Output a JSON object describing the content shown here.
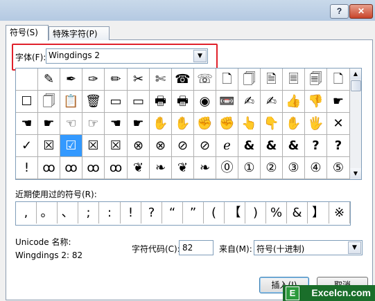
{
  "titlebar": {
    "help": "?",
    "close": "✕"
  },
  "tabs": [
    {
      "label": "符号(S)"
    },
    {
      "label": "特殊字符(P)"
    }
  ],
  "font": {
    "label": "字体(F):",
    "value": "Wingdings 2"
  },
  "grid": {
    "rows": [
      [
        "",
        "✎",
        "✒",
        "✑",
        "✏",
        "✂",
        "✄",
        "☎",
        "☏",
        "🗋",
        "🗍",
        "🗎",
        "🗏",
        "🗐",
        "🗋"
      ],
      [
        "☐",
        "🗍",
        "📋",
        "🗑",
        "▭",
        "▭",
        "🖶",
        "🖶",
        "◉",
        "📼",
        "✍",
        "✍",
        "👍",
        "👎",
        "☛"
      ],
      [
        "☚",
        "☛",
        "☜",
        "☞",
        "☚",
        "☛",
        "✋",
        "✋",
        "✊",
        "✊",
        "👆",
        "👇",
        "✋",
        "🖐",
        "✕"
      ],
      [
        "✓",
        "☒",
        "☑",
        "☒",
        "☒",
        "⊗",
        "⊗",
        "⊘",
        "⊘",
        "ℯ",
        "&",
        "&",
        "&",
        "?",
        "?"
      ],
      [
        "!",
        "ꝏ",
        "ꝏ",
        "ꝏ",
        "ꝏ",
        "❦",
        "❧",
        "❦",
        "❧",
        "⓪",
        "①",
        "②",
        "③",
        "④",
        "⑤"
      ]
    ],
    "last_col": [
      "🗋",
      "☛",
      "✕",
      "?",
      "⑥"
    ],
    "selected": {
      "row": 3,
      "col": 2
    }
  },
  "recent": {
    "label": "近期使用过的符号(R):",
    "items": [
      ",",
      "。",
      "、",
      ";",
      ":",
      "!",
      "?",
      "“",
      "”",
      "(",
      "【",
      ")",
      "%",
      "&",
      "】",
      "※"
    ]
  },
  "unicode": {
    "label": "Unicode 名称:",
    "name": "Wingdings 2: 82"
  },
  "code": {
    "label": "字符代码(C):",
    "value": "82"
  },
  "from": {
    "label": "来自(M):",
    "value": "符号(十进制)"
  },
  "buttons": {
    "insert": "插入(I)",
    "cancel": "取消"
  },
  "watermark": {
    "text": "Excelcn.com",
    "badge": "E"
  }
}
